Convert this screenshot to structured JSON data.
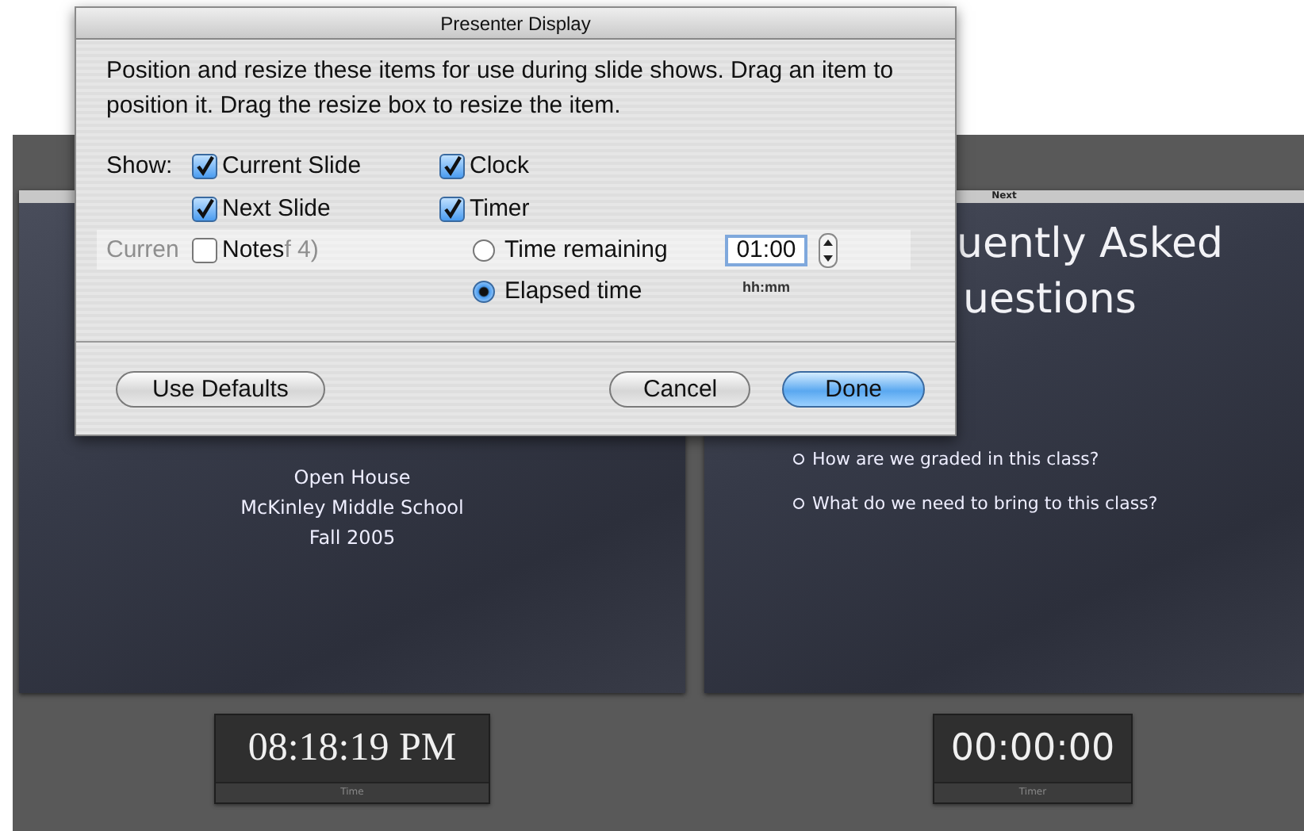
{
  "dialog": {
    "title": "Presenter Display",
    "description": "Position and resize these items for use during slide shows. Drag an item to position it. Drag the resize box to resize the item.",
    "show_label": "Show:",
    "column_1": [
      {
        "label": "Current Slide",
        "checked": true
      },
      {
        "label": "Next Slide",
        "checked": true
      },
      {
        "label": "Notes",
        "checked": false
      }
    ],
    "column_2": [
      {
        "label": "Clock",
        "checked": true
      },
      {
        "label": "Timer",
        "checked": true
      }
    ],
    "background_label_fragments": [
      "Curren",
      "f 4)"
    ],
    "timer_modes": [
      {
        "label": "Time remaining",
        "selected": false
      },
      {
        "label": "Elapsed time",
        "selected": true
      }
    ],
    "duration": {
      "value": "01:00",
      "hint": "hh:mm"
    },
    "buttons": [
      {
        "label": "Use Defaults",
        "kind": "plain"
      },
      {
        "label": "Cancel",
        "kind": "plain"
      },
      {
        "label": "Done",
        "kind": "default"
      }
    ]
  },
  "current_slide": {
    "lines": [
      "Open House",
      "McKinley Middle School",
      "Fall 2005"
    ]
  },
  "next_slide": {
    "header": "Next",
    "title_lines": [
      "uently Asked",
      "uestions"
    ],
    "bullets": [
      "How are we graded in this class?",
      "What do we need to bring to this class?"
    ]
  },
  "clock": {
    "value": "08:18:19 PM",
    "label": "Time"
  },
  "timer": {
    "value": "00:00:00",
    "label": "Timer"
  }
}
